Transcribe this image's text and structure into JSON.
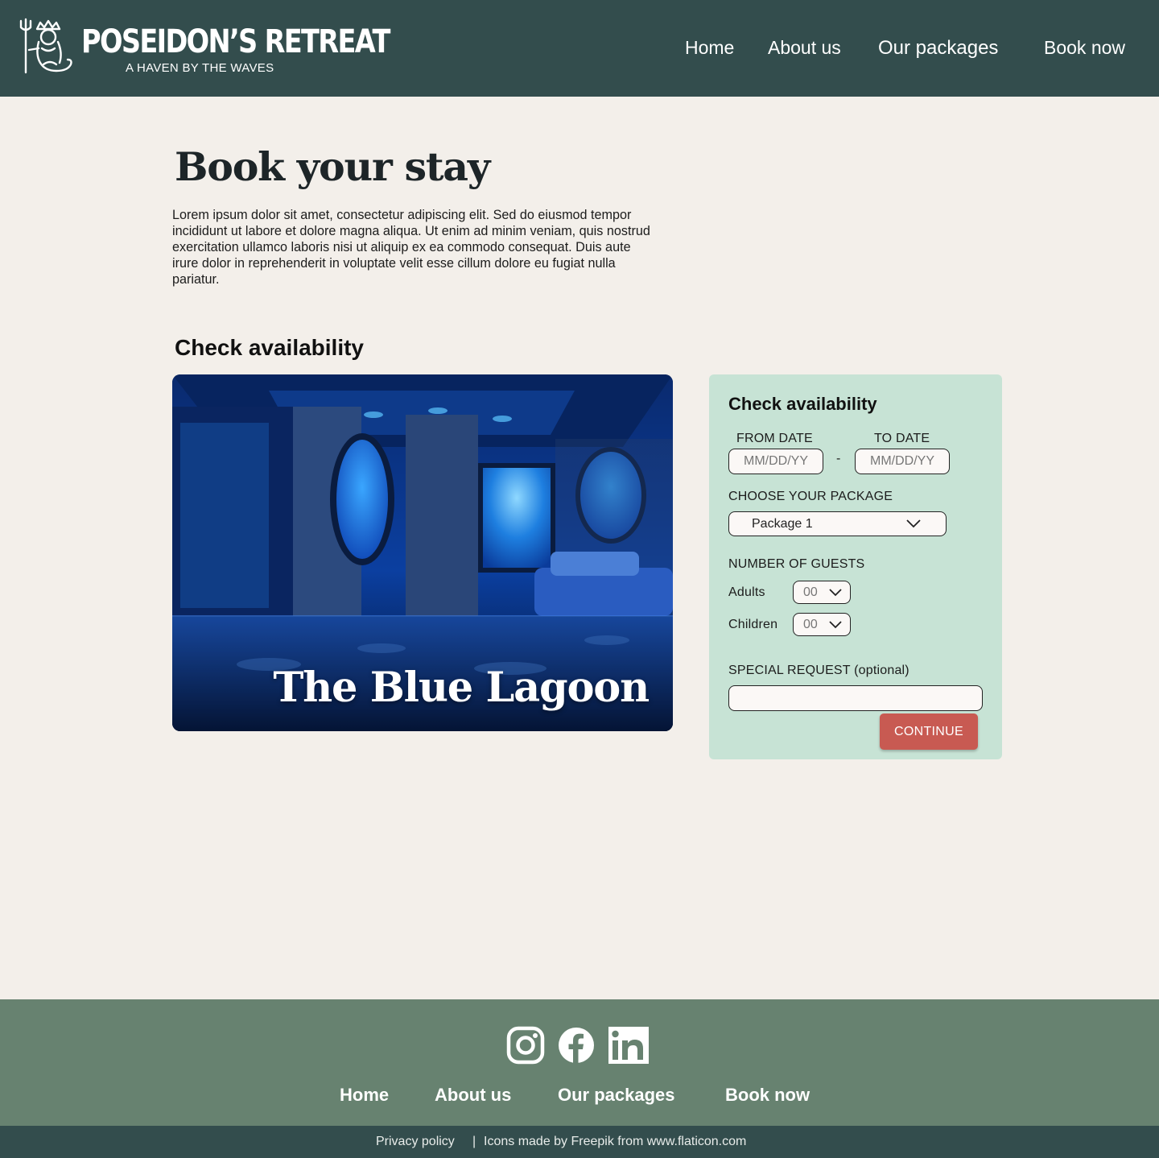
{
  "header": {
    "brand_name": "POSEIDON’S RETREAT",
    "tagline": "A HAVEN BY THE WAVES",
    "logo_icon": "poseidon-trident-icon",
    "nav": [
      "Home",
      "About us",
      "Our packages",
      "Book now"
    ]
  },
  "main": {
    "title": "Book your stay",
    "intro": "Lorem ipsum dolor sit amet, consectetur adipiscing elit. Sed do eiusmod tempor incididunt ut labore et dolore magna aliqua. Ut enim ad minim veniam, quis nostrud exercitation ullamco laboris nisi ut aliquip ex ea commodo consequat. Duis aute irure dolor in reprehenderit in voluptate velit esse cillum dolore eu fugiat nulla pariatur.",
    "section_title": "Check availability",
    "photo_caption": "The Blue Lagoon"
  },
  "form": {
    "title": "Check availability",
    "from_label": "FROM DATE",
    "to_label": "TO DATE",
    "from_placeholder": "MM/DD/YY",
    "to_placeholder": "MM/DD/YY",
    "separator": "-",
    "package_label": "CHOOSE YOUR PACKAGE",
    "package_value": "Package 1",
    "guests_label": "NUMBER OF GUESTS",
    "adults_label": "Adults",
    "adults_value": "00",
    "children_label": "Children",
    "children_value": "00",
    "special_label": "SPECIAL REQUEST (optional)",
    "special_value": "",
    "continue_label": "CONTINUE"
  },
  "footer": {
    "social_icons": [
      "instagram-icon",
      "facebook-icon",
      "linkedin-icon"
    ],
    "nav": [
      "Home",
      "About us",
      "Our packages",
      "Book now"
    ],
    "privacy": "Privacy policy",
    "separator": "|",
    "credit": "Icons made by Freepik from www.flaticon.com"
  },
  "colors": {
    "header_bg": "#334d4d",
    "page_bg": "#f3efea",
    "panel_bg": "#c7e3d5",
    "button_bg": "#c85a52",
    "footer_bg": "#678270"
  }
}
